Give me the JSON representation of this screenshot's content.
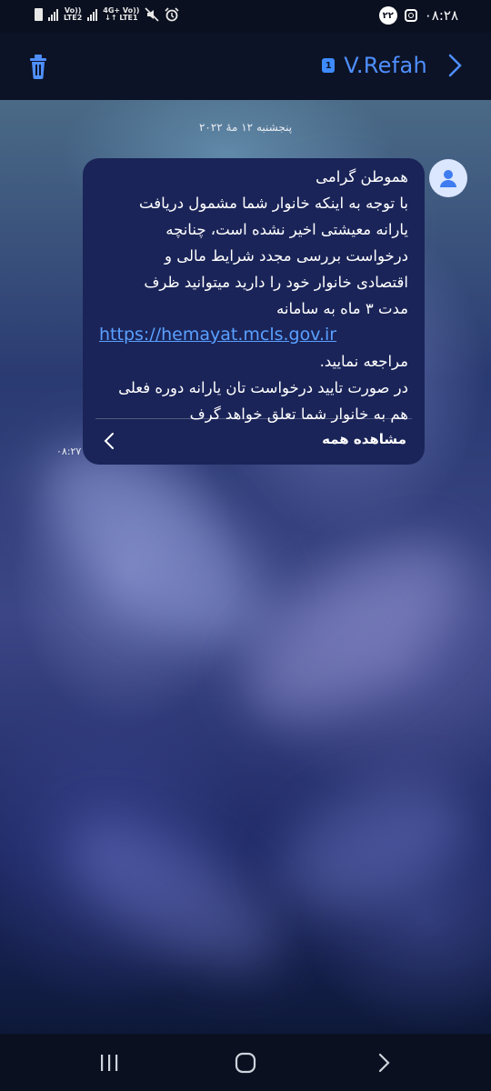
{
  "status_bar": {
    "time": "۰۸:۲۸",
    "notification_count": "۲۲",
    "sim2_label_top": "Vo))",
    "sim2_label_bottom": "LTE2",
    "sim1_label_top": "4G+ Vo))",
    "sim1_label_bottom": "↓↑ LTE1"
  },
  "header": {
    "contact_name": "V.Refah",
    "sim_badge": "1"
  },
  "conversation": {
    "date_divider": "پنجشنبه ۱۲ مهٔ ۲۰۲۲",
    "message": {
      "lines": [
        "هموطن گرامی",
        "با توجه به اینکه خانوار شما مشمول دریافت",
        "یارانه معیشتی اخیر نشده است، چنانچه",
        "درخواست بررسی مجدد شرایط مالی و",
        "اقتصادی خانوار خود را دارید میتوانید ظرف",
        "مدت ۳ ماه به سامانه"
      ],
      "link": "https://hemayat.mcls.gov.ir",
      "lines_after": [
        "مراجعه نمایید.",
        "در صورت تایید درخواست تان یارانه دوره فعلی",
        "هم به خانوار شما تعلق خواهد گرف"
      ],
      "view_all": "مشاهده همه",
      "time": "۰۸:۲۷"
    }
  },
  "icons": {
    "trash": "trash-icon",
    "back": "chevron-right-icon",
    "avatar": "person-icon"
  },
  "colors": {
    "accent": "#4f8fff",
    "bubble": "#1a2458",
    "link": "#5aa0ff"
  }
}
